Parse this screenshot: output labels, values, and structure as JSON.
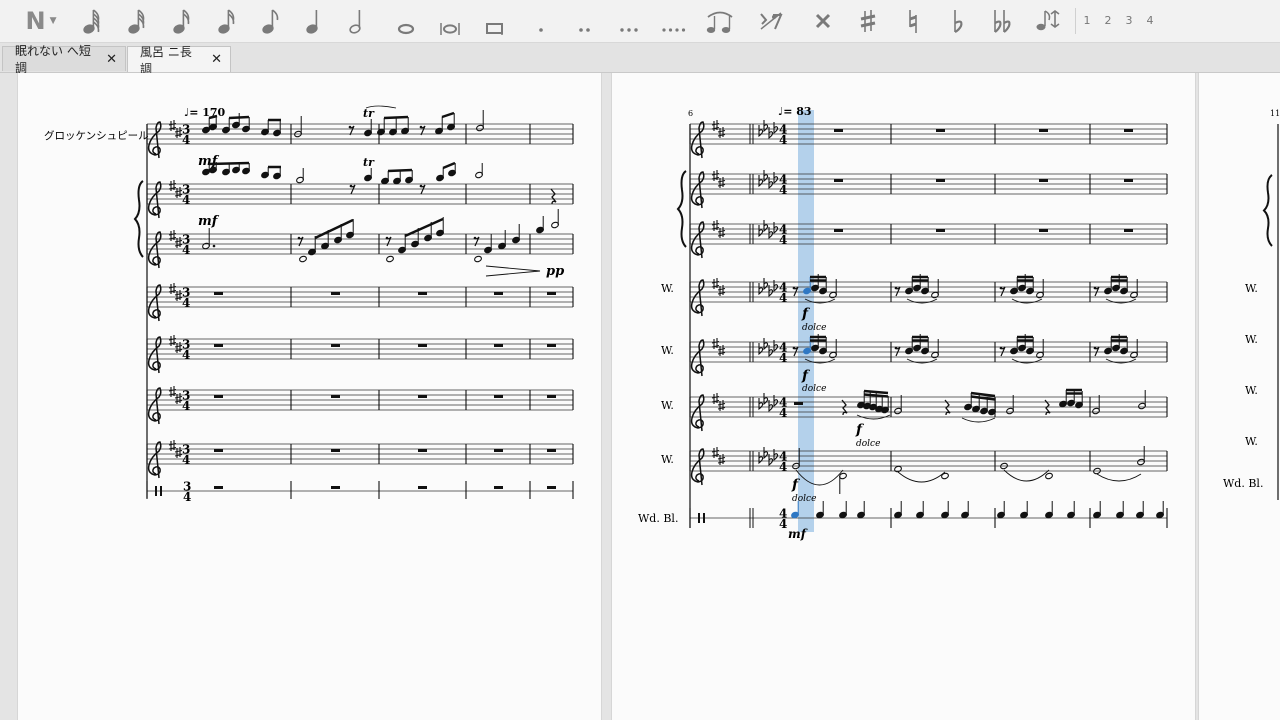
{
  "toolbar": {
    "note_input_icon": "N",
    "voices": [
      "1",
      "2",
      "3",
      "4"
    ]
  },
  "tabs": [
    {
      "label": "眠れない へ短調",
      "active": false
    },
    {
      "label": "風呂 ニ長調",
      "active": true
    }
  ],
  "score_left": {
    "tempo": "♩= 170",
    "instrument_top": "グロッケンシュピール",
    "dyn_mf_1": "mf",
    "dyn_mf_2": "mf",
    "dyn_pp": "pp",
    "trill_1": "tr",
    "trill_2": "tr",
    "time_num": "3",
    "time_den": "4"
  },
  "score_right": {
    "measure_number": "6",
    "tempo": "♩= 83",
    "labels": [
      "W.",
      "W.",
      "W.",
      "W.",
      "Wd. Bl."
    ],
    "dyn_f": [
      "f",
      "f",
      "f",
      "f"
    ],
    "dolce": [
      "dolce",
      "dolce",
      "dolce",
      "dolce"
    ],
    "dyn_mf": "mf",
    "time_num": "4",
    "time_den": "4"
  },
  "score_far": {
    "measure_number": "11",
    "labels": [
      "W.",
      "W.",
      "W.",
      "W.",
      "Wd. Bl."
    ]
  },
  "colors": {
    "selection": "#9cc3e6",
    "selected_note": "#2f78c4",
    "ink": "#111111"
  }
}
